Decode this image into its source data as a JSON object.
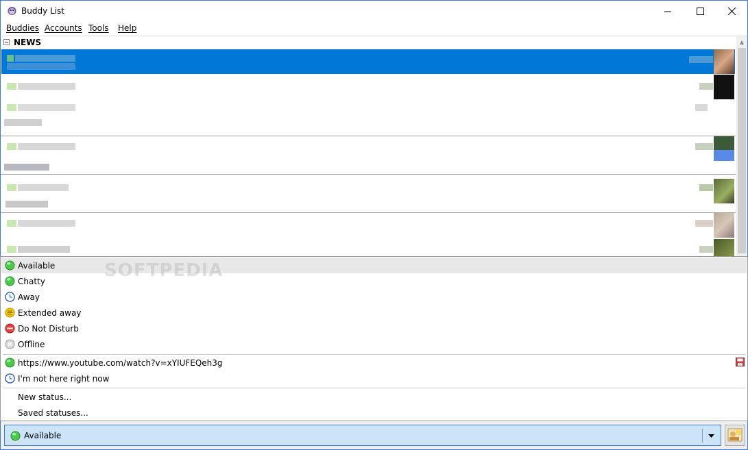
{
  "window": {
    "title": "Buddy List",
    "buttons": [
      "minimize",
      "maximize",
      "close"
    ]
  },
  "menubar": {
    "items": [
      {
        "label": "Buddies"
      },
      {
        "label": "Accounts"
      },
      {
        "label": "Tools"
      },
      {
        "label": "Help"
      }
    ]
  },
  "buddy_list": {
    "group": {
      "name": "NEWS",
      "expanded": true
    },
    "selected_color": "#0078d7"
  },
  "status_menu": {
    "watermark": "SOFTPEDIA",
    "primary": [
      {
        "label": "Available",
        "icon": "available-icon",
        "color": "#3cb43c"
      },
      {
        "label": "Chatty",
        "icon": "chatty-icon",
        "color": "#3cb43c"
      },
      {
        "label": "Away",
        "icon": "away-clock-icon",
        "color": "#2a5aa8"
      },
      {
        "label": "Extended away",
        "icon": "extended-away-icon",
        "color": "#e8a800"
      },
      {
        "label": "Do Not Disturb",
        "icon": "do-not-disturb-icon",
        "color": "#d83030"
      },
      {
        "label": "Offline",
        "icon": "offline-icon",
        "color": "#b0b0b0"
      }
    ],
    "saved": [
      {
        "label": "https://www.youtube.com/watch?v=xYIUFEQeh3g",
        "icon": "available-icon"
      },
      {
        "label": "I'm not here right now",
        "icon": "away-clock-icon"
      }
    ],
    "actions": [
      {
        "label": "New status..."
      },
      {
        "label": "Saved statuses..."
      }
    ]
  },
  "status_selector": {
    "value": "Available",
    "icon": "available-icon"
  }
}
